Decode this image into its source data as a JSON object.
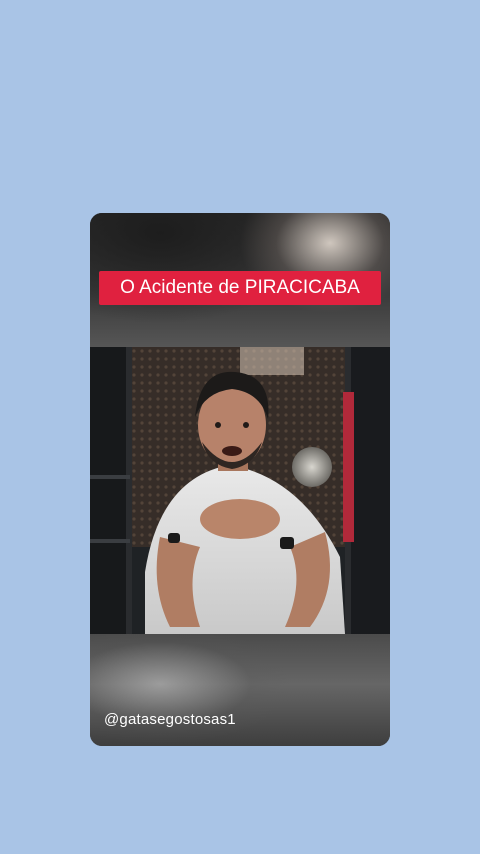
{
  "video": {
    "title_caption": "O Acidente de PIRACICABA",
    "username": "@gatasegostosas1",
    "background_color": "#a9c4e6",
    "caption_color": "#e0213f"
  }
}
